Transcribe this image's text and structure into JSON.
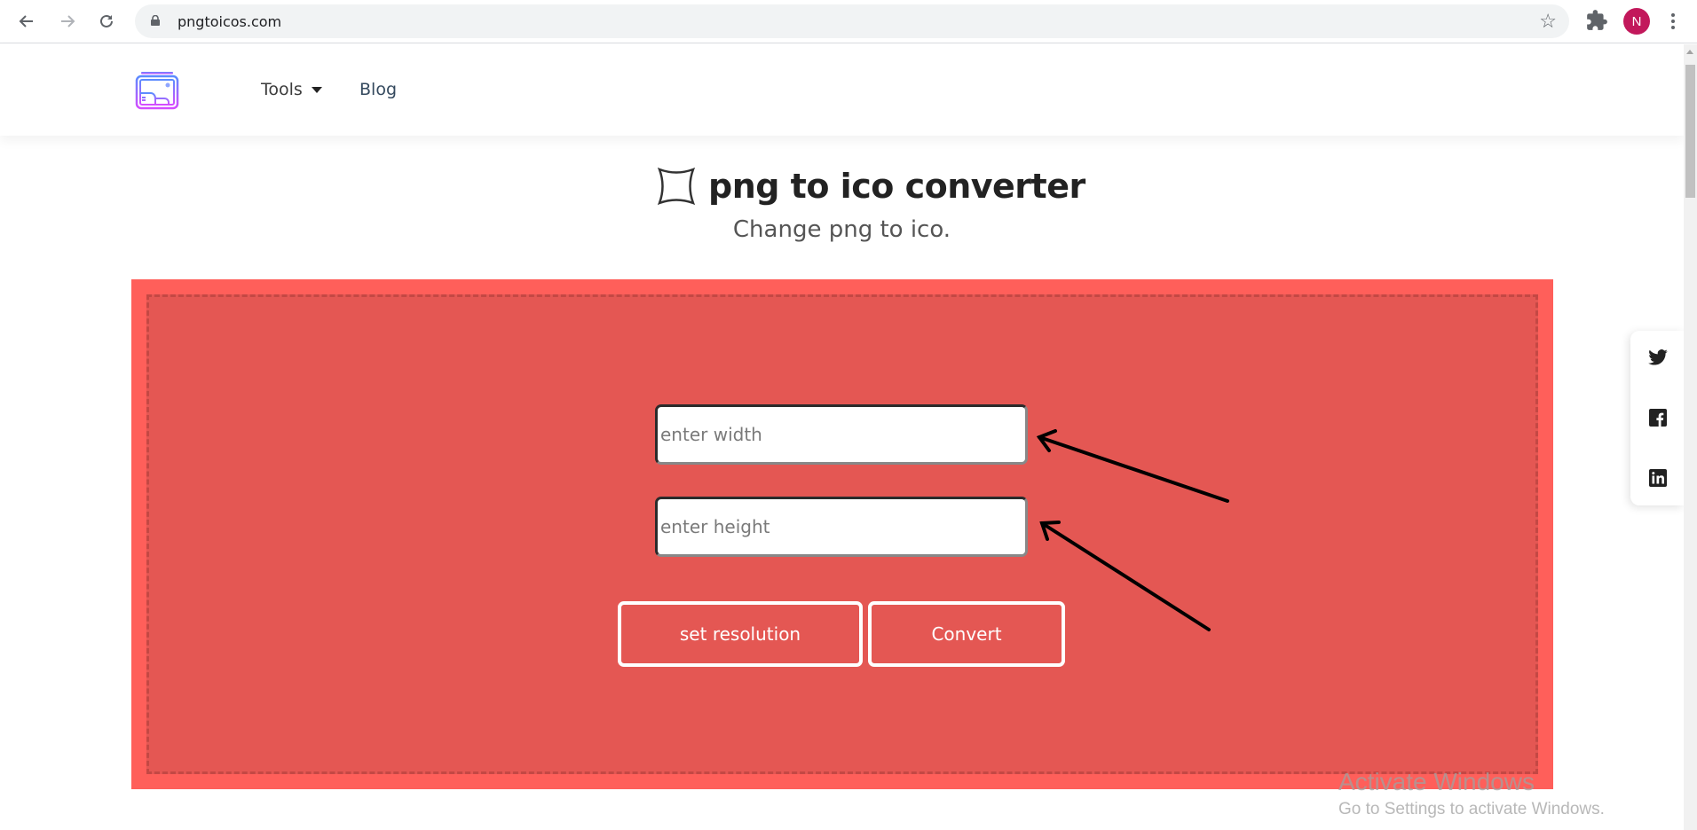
{
  "browser": {
    "url": "pngtoicos.com",
    "profile_initial": "N",
    "profile_color": "#c2185b",
    "icons": [
      "back-icon",
      "forward-icon",
      "reload-icon",
      "lock-icon",
      "bookmark-star-icon",
      "extensions-icon",
      "menu-icon"
    ]
  },
  "header": {
    "nav": [
      {
        "label": "Tools",
        "has_dropdown": true
      },
      {
        "label": "Blog"
      }
    ]
  },
  "main": {
    "title": "png to ico converter",
    "subtitle": "Change png to ico.",
    "width_field": {
      "placeholder": "enter width",
      "value": ""
    },
    "height_field": {
      "placeholder": "enter height",
      "value": ""
    },
    "set_resolution_label": "set resolution",
    "convert_label": "Convert",
    "colors": {
      "dropzone_outer": "#ff5f5a",
      "dropzone_inner": "#e45753",
      "accent_border": "#c44844"
    }
  },
  "social": {
    "items": [
      "twitter",
      "facebook",
      "linkedin"
    ]
  },
  "watermark": {
    "title": "Activate Windows",
    "subtitle": "Go to Settings to activate Windows."
  }
}
